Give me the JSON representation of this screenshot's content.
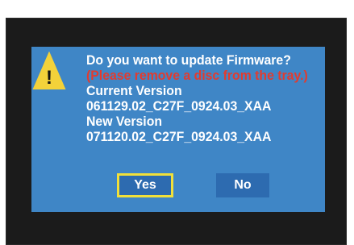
{
  "dialog": {
    "lines": [
      "Do you want to update Firmware?",
      "(Please remove a disc from the tray.)",
      "Current Version",
      "061129.02_C27F_0924.03_XAA",
      "New Version",
      "071120.02_C27F_0924.03_XAA"
    ],
    "warning_symbol": "!",
    "icon": "warning-icon"
  },
  "buttons": {
    "yes_label": "Yes",
    "no_label": "No"
  },
  "colors": {
    "dialog_bg": "#3f86c6",
    "button_bg": "#2d6bb0",
    "focus_border": "#f1e03a",
    "warning_text": "#e23b2f",
    "screen_bg": "#1b1b1b"
  }
}
